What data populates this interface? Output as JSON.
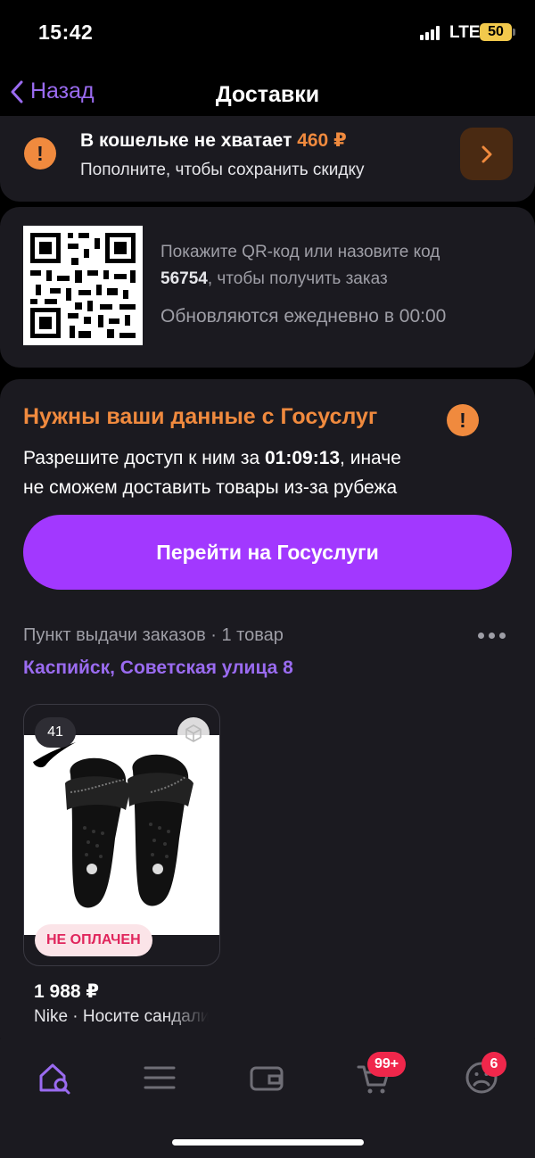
{
  "status": {
    "time": "15:42",
    "network": "LTE",
    "battery": "50"
  },
  "nav": {
    "back_label": "Назад",
    "title": "Доставки"
  },
  "wallet": {
    "warn_symbol": "!",
    "title_prefix": "В кошельке не хватает",
    "amount": "460 ₽",
    "subtitle": "Пополните, чтобы сохранить скидку"
  },
  "qr": {
    "instruction_line1": "Покажите QR-код или назовите код",
    "code": "56754",
    "instruction_line2": ", чтобы получить заказ",
    "refresh_text": "Обновляются ежедневно в 00:00"
  },
  "gosuslugi": {
    "title": "Нужны ваши данные с Госуслуг",
    "warn_symbol": "!",
    "desc_prefix": "Разрешите доступ к ним за",
    "timer": "01:09:13",
    "desc_suffix": ", иначе",
    "desc_line2": "не сможем доставить товары из-за рубежа",
    "button_label": "Перейти на Госуслуги"
  },
  "pickup": {
    "line": "Пункт выдачи заказов · 1 товар",
    "address": "Каспийск, Советская улица 8"
  },
  "product": {
    "size": "41",
    "status_badge": "НЕ ОПЛАЧЕН",
    "price": "1 988 ₽",
    "name": "Nike · Носите сандалии"
  },
  "tabbar": {
    "items": [
      {
        "icon": "home-search-icon",
        "active": true
      },
      {
        "icon": "catalog-menu-icon"
      },
      {
        "icon": "wallet-icon"
      },
      {
        "icon": "cart-icon",
        "badge": "99+"
      },
      {
        "icon": "profile-icon",
        "badge": "6"
      }
    ]
  },
  "colors": {
    "accent": "#a238ff",
    "link": "#9a6bf0",
    "warning": "#f08a3e",
    "badge": "#f0274b",
    "card": "#1b1a20"
  }
}
